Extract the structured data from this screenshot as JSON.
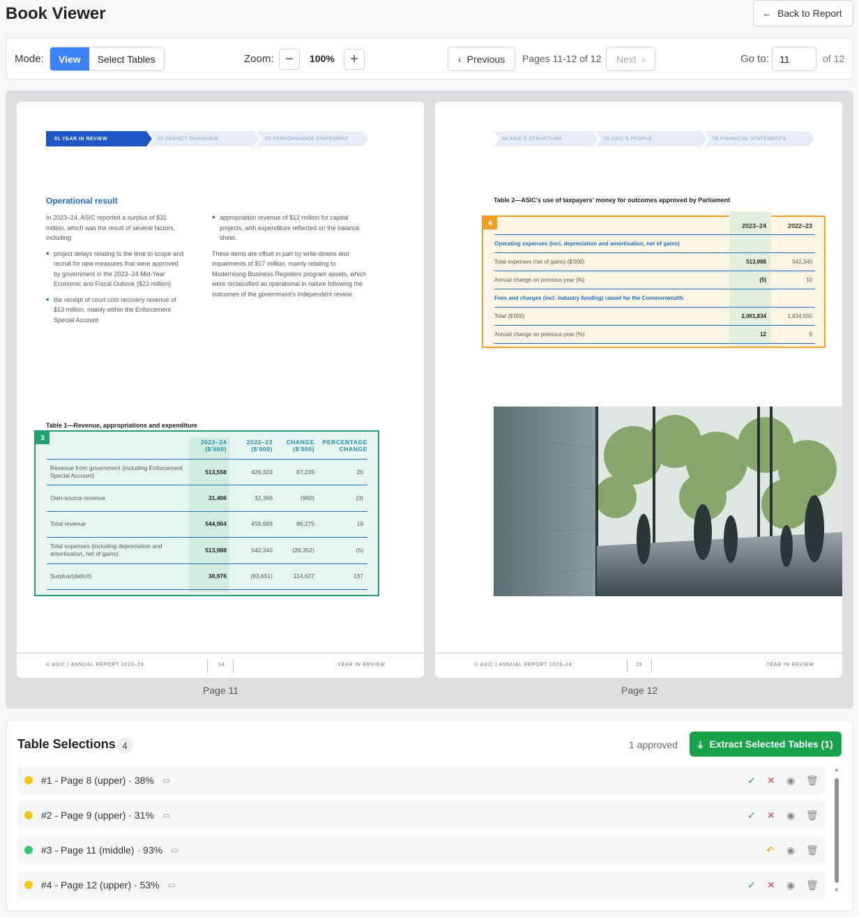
{
  "header": {
    "title": "Book Viewer",
    "back_label": "Back to Report"
  },
  "toolbar": {
    "mode_label": "Mode:",
    "mode_options": [
      "View",
      "Select Tables"
    ],
    "zoom_label": "Zoom:",
    "zoom_value": "100%",
    "prev_label": "Previous",
    "pages_info": "Pages 11-12 of 12",
    "next_label": "Next",
    "goto_label": "Go to:",
    "goto_value": "11",
    "goto_total": "of 12"
  },
  "page11": {
    "caption": "Page 11",
    "breadcrumb": [
      "01  YEAR IN REVIEW",
      "02  AGENCY OVERVIEW",
      "03  PERFORMANCE STATEMENT"
    ],
    "heading": "Operational result",
    "para1": "In 2023–24, ASIC reported a surplus of $31 million, which was the result of several factors, including:",
    "bullet1": "project delays relating to the time to scope and recruit for new measures that were approved by government in the 2023–24 Mid-Year Economic and Fiscal Outlook ($23 million)",
    "bullet2": "the receipt of court cost recovery revenue of $13 million, mainly within the Enforcement Special Account",
    "bullet3": "appropriation revenue of $12 million for capital projects, with expenditure reflected on the balance sheet.",
    "para2": "These items are offset in part by write-downs and impairments of $17 million, mainly relating to Modernising Business Registers program assets, which were reclassified as operational in nature following the outcomes of the government's independent review.",
    "table_title": "Table 1—Revenue, appropriations and expenditure",
    "table_badge": "3",
    "table_headers": [
      "2023–24 ($'000)",
      "2022–23 ($'000)",
      "CHANGE ($'000)",
      "PERCENTAGE CHANGE"
    ],
    "table_rows": [
      {
        "label": "Revenue from government (including Enforcement Special Account)",
        "v1": "513,558",
        "v2": "426,323",
        "v3": "87,235",
        "v4": "20"
      },
      {
        "label": "Own-source revenue",
        "v1": "31,406",
        "v2": "32,366",
        "v3": "(960)",
        "v4": "(3)"
      },
      {
        "label": "Total revenue",
        "v1": "544,964",
        "v2": "458,689",
        "v3": "86,275",
        "v4": "19"
      },
      {
        "label": "Total expenses (including depreciation and amortisation, net of gains)",
        "v1": "513,988",
        "v2": "542,340",
        "v3": "(28,352)",
        "v4": "(5)"
      },
      {
        "label": "Surplus/(deficit)",
        "v1": "30,976",
        "v2": "(83,651)",
        "v3": "114,627",
        "v4": "137"
      }
    ],
    "footer_left": "© ASIC | ANNUAL REPORT 2023–24",
    "footer_num": "14",
    "footer_right": "YEAR IN REVIEW"
  },
  "page12": {
    "caption": "Page 12",
    "breadcrumb": [
      "04  ASIC'S STRUCTURE",
      "05  ASIC'S PEOPLE",
      "06  FINANCIAL STATEMENTS"
    ],
    "table_title": "Table 2—ASIC's use of taxpayers' money for outcomes approved by Parliament",
    "table_badge": "4",
    "table_headers": [
      "2023–24",
      "2022–23"
    ],
    "section1": "Operating expenses (incl. depreciation and amortisation, net of gains)",
    "rows1": [
      {
        "label": "Total expenses (net of gains) ($'000)",
        "v1": "513,988",
        "v2": "542,340"
      },
      {
        "label": "Annual change on previous year (%)",
        "v1": "(5)",
        "v2": "10"
      }
    ],
    "section2": "Fees and charges (incl. industry funding) raised for the Commonwealth",
    "rows2": [
      {
        "label": "Total ($'000)",
        "v1": "2,061,834",
        "v2": "1,834,550"
      },
      {
        "label": "Annual change on previous year (%)",
        "v1": "12",
        "v2": "9"
      }
    ],
    "footer_left": "© ASIC | ANNUAL REPORT 2023–24",
    "footer_num": "15",
    "footer_right": "YEAR IN REVIEW"
  },
  "selections": {
    "title": "Table Selections",
    "count": "4",
    "approved": "1 approved",
    "extract_label": "Extract Selected Tables (1)",
    "items": [
      {
        "label": "#1 - Page 8 (upper) · 38%",
        "status_color": "#f5c518",
        "approved": false
      },
      {
        "label": "#2 - Page 9 (upper) · 31%",
        "status_color": "#f5c518",
        "approved": false
      },
      {
        "label": "#3 - Page 11 (middle) · 93%",
        "status_color": "#2ecc71",
        "approved": true
      },
      {
        "label": "#4 - Page 12 (upper) · 53%",
        "status_color": "#f5c518",
        "approved": false
      }
    ]
  },
  "colors": {
    "accent": "#3b82f6",
    "extract": "#16a34a",
    "table3": "#22a06b",
    "table4": "#f0a020"
  }
}
